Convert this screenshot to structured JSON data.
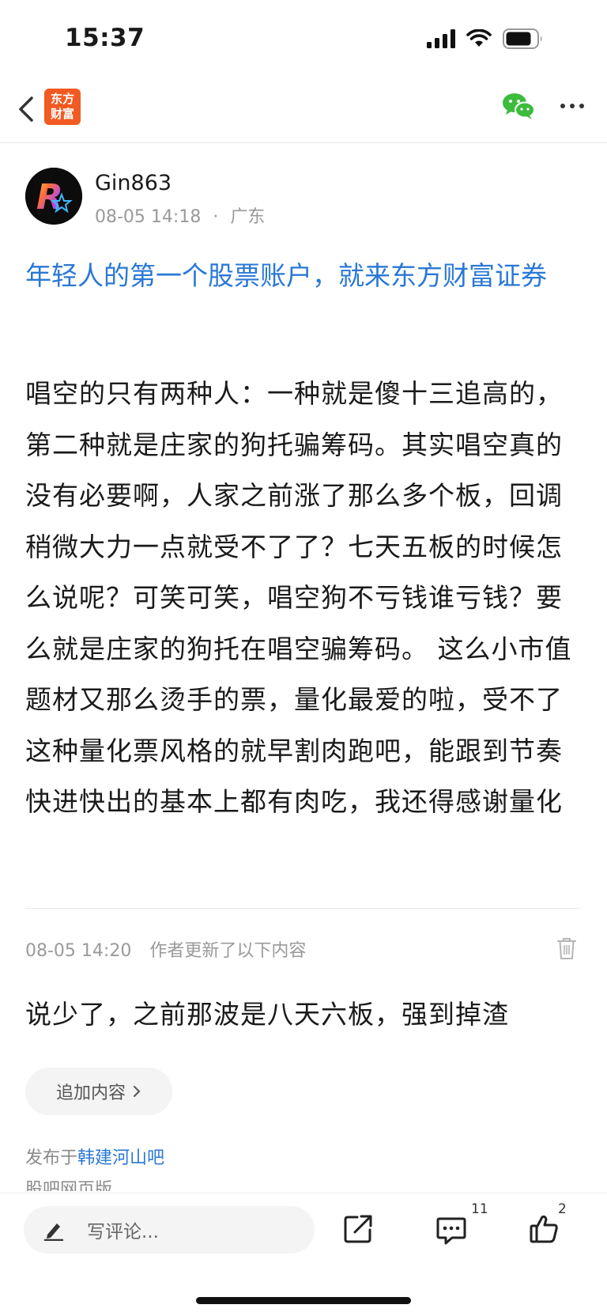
{
  "status_bar": {
    "time": "15:37"
  },
  "nav": {
    "logo_line1": "东方",
    "logo_line2": "财富"
  },
  "author": {
    "name": "Gin863",
    "date": "08-05 14:18",
    "separator": "·",
    "location": "广东"
  },
  "promo": {
    "text": "年轻人的第一个股票账户，就来东方财富证券"
  },
  "post": {
    "body": "唱空的只有两种人：一种就是傻十三追高的，第二种就是庄家的狗托骗筹码。其实唱空真的没有必要啊，人家之前涨了那么多个板，回调稍微大力一点就受不了了？七天五板的时候怎么说呢？可笑可笑，唱空狗不亏钱谁亏钱？要么就是庄家的狗托在唱空骗筹码。  这么小市值题材又那么烫手的票，量化最爱的啦，受不了这种量化票风格的就早割肉跑吧，能跟到节奏快进快出的基本上都有肉吃，我还得感谢量化"
  },
  "update": {
    "time": "08-05 14:20",
    "label": "作者更新了以下内容",
    "text": "说少了，之前那波是八天六板，强到掉渣"
  },
  "append_button": {
    "label": "追加内容"
  },
  "publish": {
    "prefix": "发布于",
    "forum": "韩建河山吧"
  },
  "web_version": "股吧网页版",
  "bottom": {
    "comment_placeholder": "写评论...",
    "comment_count": "11",
    "like_count": "2"
  },
  "colors": {
    "brand": "#f15a22",
    "link": "#2a78d6",
    "wechat": "#3dbb3d"
  },
  "icons": [
    "back-icon",
    "wechat-icon",
    "more-icon",
    "trash-icon",
    "chevron-right-icon",
    "pen-icon",
    "share-icon",
    "comment-icon",
    "like-icon"
  ]
}
